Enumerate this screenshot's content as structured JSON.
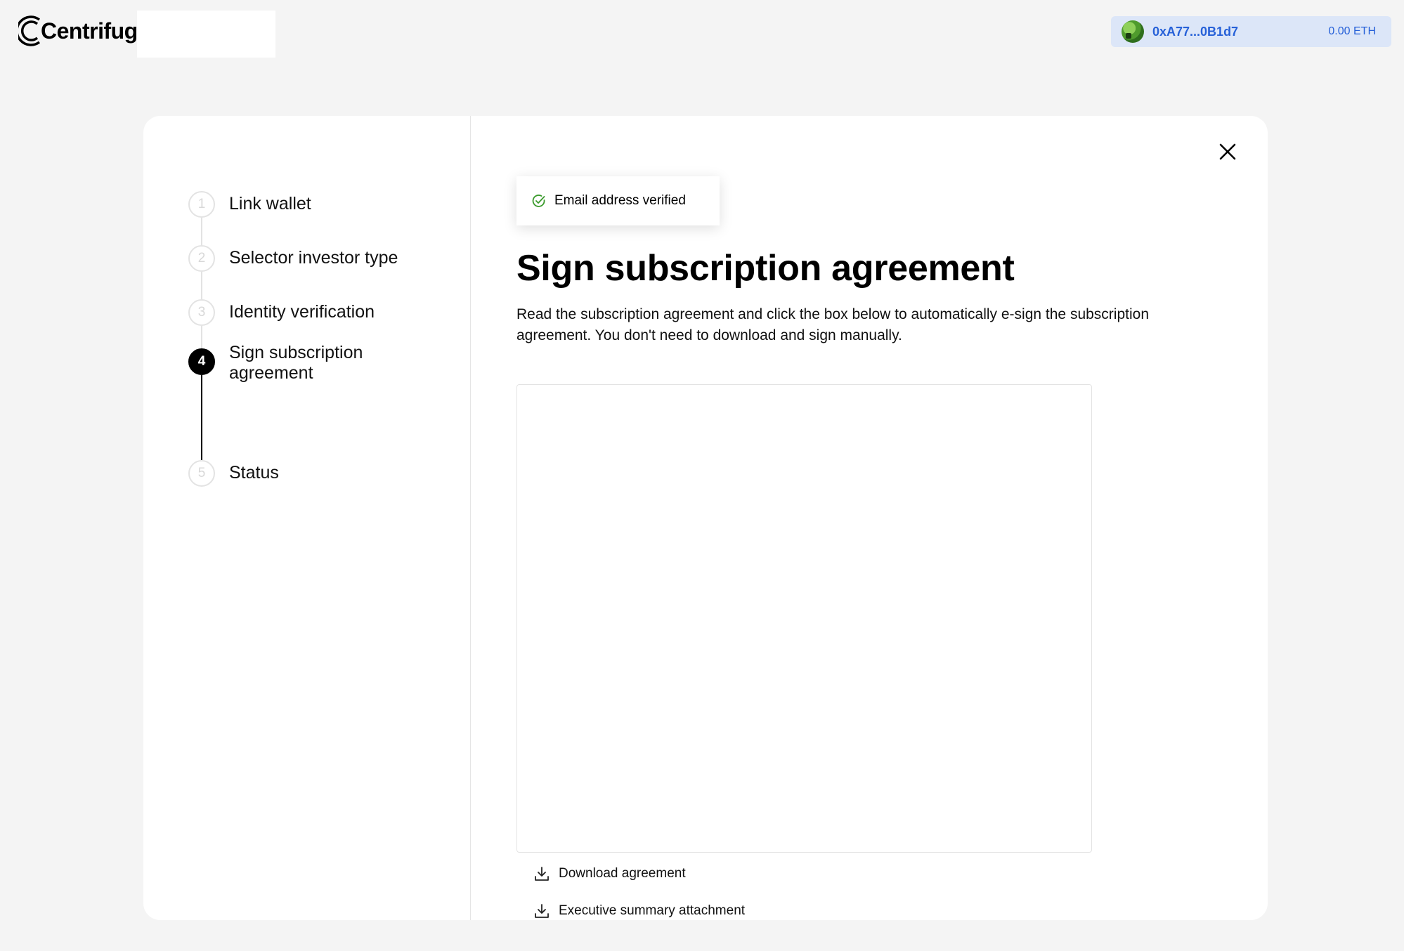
{
  "header": {
    "brand": "Centrifuge",
    "wallet": {
      "address": "0xA77...0B1d7",
      "balance": "0.00 ETH"
    }
  },
  "stepper": {
    "current_step": 4,
    "steps": [
      {
        "number": "1",
        "label": "Link wallet"
      },
      {
        "number": "2",
        "label": "Selector investor type"
      },
      {
        "number": "3",
        "label": "Identity verification"
      },
      {
        "number": "4",
        "label": "Sign subscription agreement"
      },
      {
        "number": "5",
        "label": "Status"
      }
    ]
  },
  "toast": {
    "message": "Email address verified",
    "icon": "check-circle-icon"
  },
  "main": {
    "title": "Sign subscription agreement",
    "description": "Read the subscription agreement and click the box below to automatically e-sign the subscription agreement. You don't need to download and sign manually.",
    "links": [
      {
        "label": "Download agreement",
        "icon": "download-icon"
      },
      {
        "label": "Executive summary attachment",
        "icon": "download-icon"
      }
    ]
  },
  "colors": {
    "accent": "#2761d8",
    "wallet_bg": "#dce6f8",
    "success": "#3a9a2c",
    "page_bg": "#f4f4f4"
  }
}
